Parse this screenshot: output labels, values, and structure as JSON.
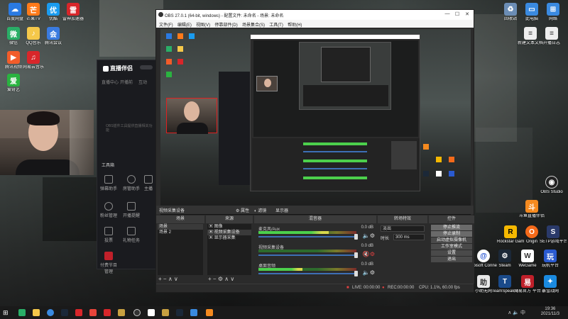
{
  "desktop_icons_left": [
    {
      "label": "百度网盘",
      "color": "#2a7ae2"
    },
    {
      "label": "芒果TV",
      "color": "#ff7a1a"
    },
    {
      "label": "优酷",
      "color": "#1a9cf0"
    },
    {
      "label": "雷神加速器",
      "color": "#d8262a"
    },
    {
      "label": "微信",
      "color": "#2aae67"
    },
    {
      "label": "QQ音乐",
      "color": "#f5c84a"
    },
    {
      "label": "腾讯会议",
      "color": "#3a7be0"
    },
    {
      "label": "腾讯视频",
      "color": "#f25c2a"
    },
    {
      "label": "网易云音乐",
      "color": "#d8262a"
    },
    {
      "label": "爱奇艺",
      "color": "#2ab340"
    }
  ],
  "desktop_icons_right": [
    {
      "label": "回收站"
    },
    {
      "label": "此电脑"
    },
    {
      "label": "网络"
    },
    {
      "label": "新建文本文档"
    },
    {
      "label": "开播日志"
    },
    {
      "label": "OBS Studio"
    },
    {
      "label": "斗鱼直播伴侣"
    },
    {
      "label": "Rockstar Games"
    },
    {
      "label": "Origin"
    },
    {
      "label": "SETP游戏平台"
    },
    {
      "label": "Ubisoft Connect"
    },
    {
      "label": "Steam"
    },
    {
      "label": "WeGame"
    },
    {
      "label": "玩机平台"
    },
    {
      "label": "小助无网"
    },
    {
      "label": "TeamSpeak 3"
    },
    {
      "label": "网易官方 平台"
    },
    {
      "label": "暴雪战网"
    }
  ],
  "assistant": {
    "logo": "直播伴侣",
    "tabs": [
      "直播中心",
      "开播前",
      "互动"
    ],
    "notice": "OBS插件工具提供直播相关功能",
    "toolbox_label": "工具箱",
    "tools": [
      "弹幕助手",
      "房管助手",
      "主播",
      "粉丝管理",
      "开播提醒",
      "投票",
      "礼物任务",
      "付费节目管理"
    ]
  },
  "obs": {
    "title": "OBS 27.0.1 (64-bit, windows) - 配置文件: 未命名 - 场景: 未命名",
    "menu": [
      "文件(F)",
      "编辑(E)",
      "视图(V)",
      "停靠部件(D)",
      "场景集合(S)",
      "工具(T)",
      "帮助(H)"
    ],
    "toolbar_labels": {
      "properties": "属性",
      "filters": "滤镜",
      "display": "显示器"
    },
    "scene_source_label": "视频采集设备",
    "scenes_title": "场景",
    "scenes": [
      "场景",
      "场景 2"
    ],
    "sources_title": "来源",
    "sources": [
      "图像",
      "视频采集设备",
      "显示器采集"
    ],
    "mixer_title": "混音器",
    "mixer": [
      {
        "name": "麦克风/Aux",
        "db": "0.0 dB",
        "level": 0.72
      },
      {
        "name": "视频采集设备",
        "db": "0.0 dB",
        "level": 0.0
      },
      {
        "name": "桌面音频",
        "db": "0.0 dB",
        "level": 0.45
      }
    ],
    "transitions_title": "转场特效",
    "transition_type": "淡出",
    "duration_label": "时长",
    "duration_value": "300 ms",
    "controls_title": "控件",
    "controls": [
      "停止推流",
      "停止录制",
      "启动虚拟摄像机",
      "工作室模式",
      "设置",
      "退出"
    ],
    "status": {
      "live_label": "LIVE:",
      "live_time": "00:00:00",
      "rec_label": "REC:",
      "rec_time": "00:00:00",
      "cpu": "CPU: 1.1%, 60.00 fps"
    }
  },
  "taskbar": {
    "time": "19:36",
    "date": "2021/11/3"
  }
}
